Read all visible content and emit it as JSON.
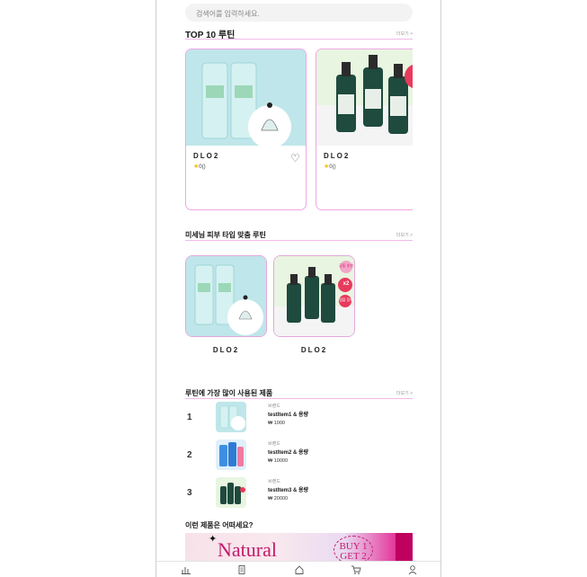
{
  "search": {
    "placeholder": "검색어를 입력하세요."
  },
  "top10": {
    "title": "TOP 10 루틴",
    "more": "더보기 >",
    "cards": [
      {
        "brand": "DLO2",
        "rating": "0()"
      },
      {
        "brand": "DLO2",
        "rating": "0()"
      }
    ]
  },
  "recommend": {
    "title": "미세님 피부 타입 맞춤 루틴",
    "more": "더보기 >",
    "items": [
      {
        "brand": "DLO2"
      },
      {
        "brand": "DLO2",
        "badge_top": "공동 추천",
        "badge_mid": "x2",
        "badge_bottom": "앰플 함께"
      }
    ]
  },
  "most_used": {
    "title": "루틴에 가장 많이 사용된 제품",
    "more": "더보기 >",
    "items": [
      {
        "rank": "1",
        "brand": "브랜드",
        "name": "testItem1 & 용량",
        "price": "₩ 1000"
      },
      {
        "rank": "2",
        "brand": "브랜드",
        "name": "testItem2 & 용량",
        "price": "₩ 10000"
      },
      {
        "rank": "3",
        "brand": "브랜드",
        "name": "testItem3 & 용량",
        "price": "₩ 20000"
      }
    ]
  },
  "banner": {
    "title": "이런 제품은 어떠세요?",
    "headline": "Natural",
    "promo": "BUY 1 GET 2"
  },
  "tabbar": {
    "icons": [
      "stats-icon",
      "list-icon",
      "home-icon",
      "cart-icon",
      "user-icon"
    ]
  },
  "colors": {
    "accent_pink": "#f0a6e6",
    "mint": "#bfe6ea",
    "green_bg": "#e8f5e0",
    "banner_magenta": "#c0005e"
  }
}
